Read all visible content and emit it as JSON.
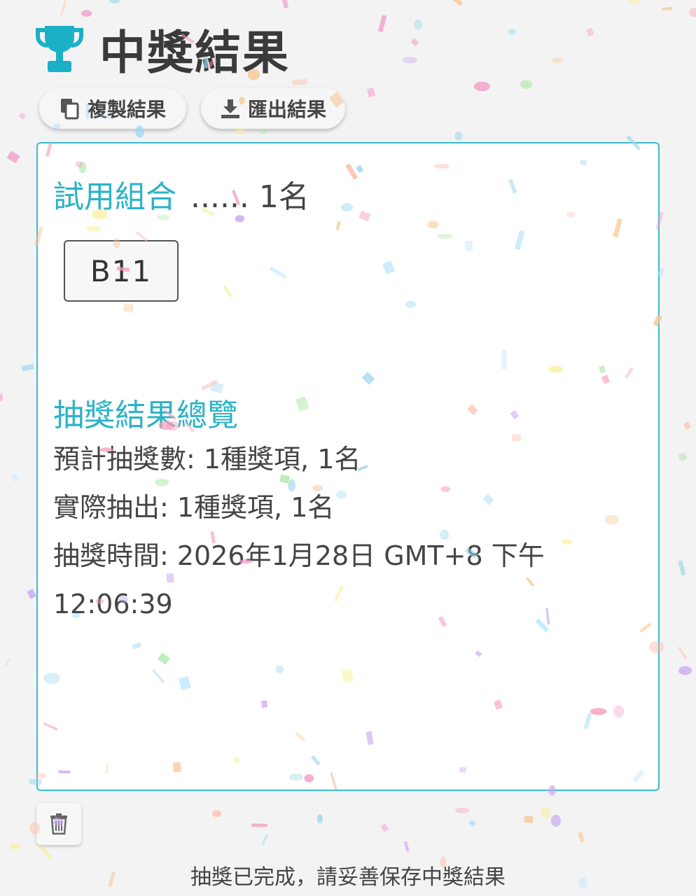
{
  "header": {
    "title": "中獎結果",
    "icon": "trophy-icon",
    "accent": "#1bb0c6"
  },
  "actions": {
    "copy_label": "複製結果",
    "copy_icon": "copy-icon",
    "export_label": "匯出結果",
    "export_icon": "download-icon"
  },
  "result": {
    "prize_name": "試用組合",
    "prize_count": "...... 1名",
    "winners": [
      "B11"
    ]
  },
  "summary": {
    "title": "抽獎結果總覽",
    "expected": "預計抽獎數: 1種獎項, 1名",
    "actual": "實際抽出: 1種獎項, 1名",
    "time": "抽獎時間: 2026年1月28日 GMT+8 下午 12:06:39"
  },
  "controls": {
    "delete_icon": "trash-icon"
  },
  "footer": {
    "note": "抽獎已完成，請妥善保存中獎結果"
  }
}
